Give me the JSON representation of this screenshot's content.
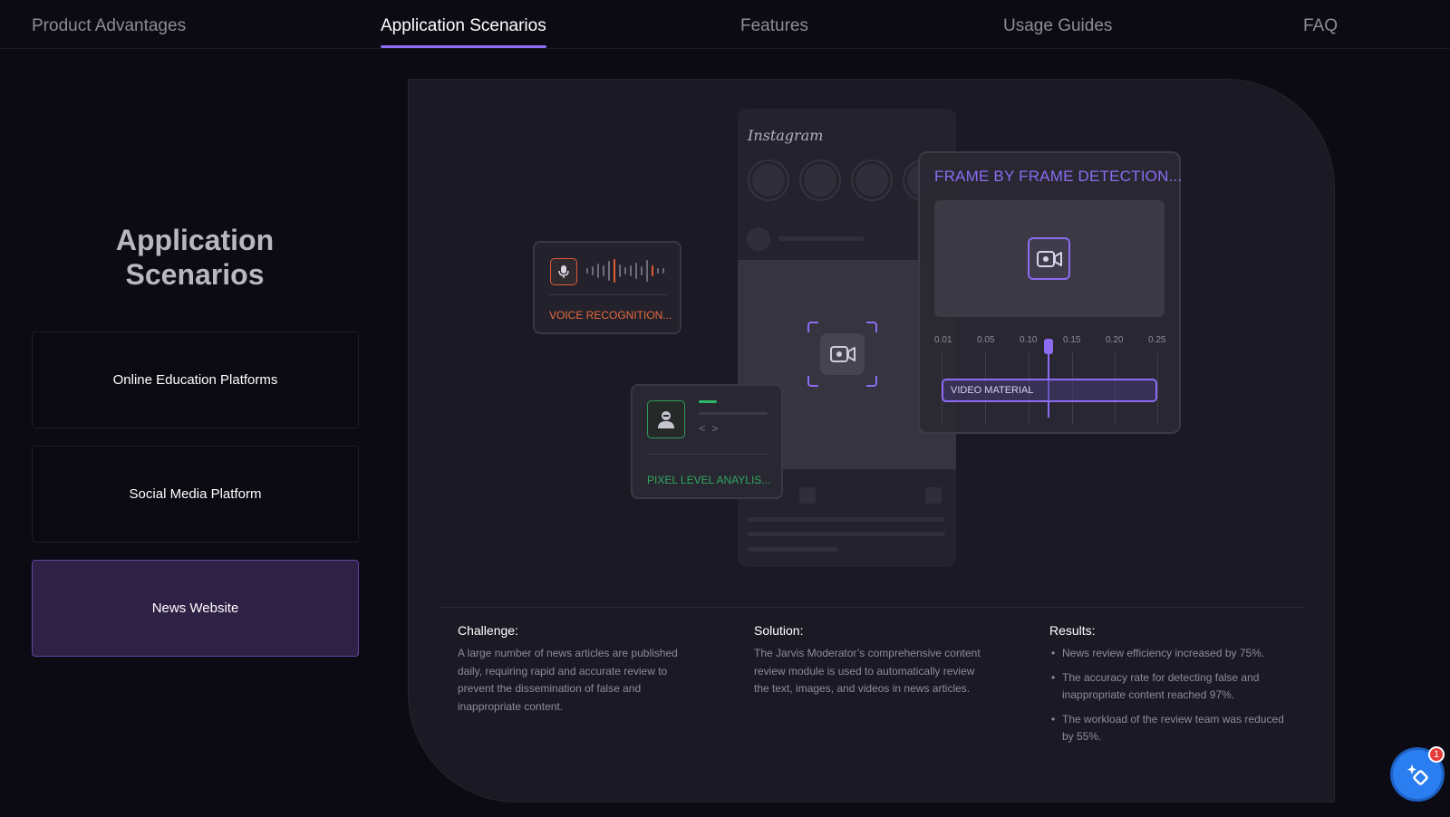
{
  "nav": {
    "tabs": [
      {
        "label": "Product Advantages"
      },
      {
        "label": "Application Scenarios",
        "active": true
      },
      {
        "label": "Features"
      },
      {
        "label": "Usage Guides"
      },
      {
        "label": "FAQ"
      }
    ]
  },
  "sidebar": {
    "title_line1": "Application",
    "title_line2": "Scenarios",
    "scenarios": [
      {
        "label": "Online Education Platforms"
      },
      {
        "label": "Social Media Platform"
      },
      {
        "label": "News Website",
        "active": true
      }
    ]
  },
  "illustration": {
    "phone_app": "Instagram",
    "voice_label": "VOICE RECOGNITION...",
    "pixel_label": "PIXEL LEVEL ANAYLIS...",
    "pixel_code": "< >",
    "frame_title": "FRAME BY FRAME DETECTION...",
    "timeline_ticks": [
      "0.01",
      "0.05",
      "0.10",
      "0.15",
      "0.20",
      "0.25"
    ],
    "material_label": "VIDEO MATERIAL"
  },
  "details": {
    "challenge": {
      "heading": "Challenge:",
      "text": "A large number of news articles are published daily, requiring rapid and accurate review to prevent the dissemination of false and inappropriate content."
    },
    "solution": {
      "heading": "Solution:",
      "text": "The Jarvis Moderator’s comprehensive content review module is used to automatically review the text, images, and videos in news articles."
    },
    "results": {
      "heading": "Results:",
      "items": [
        "News review efficiency increased by 75%.",
        "The accuracy rate for detecting false and inappropriate content reached 97%.",
        "The workload of the review team was reduced by 55%."
      ]
    }
  },
  "assistant": {
    "badge": "1"
  },
  "colors": {
    "accent": "#8b6cf2",
    "voice": "#e86a3d",
    "pixel": "#2fae63",
    "assistant": "#2a7ef0"
  }
}
